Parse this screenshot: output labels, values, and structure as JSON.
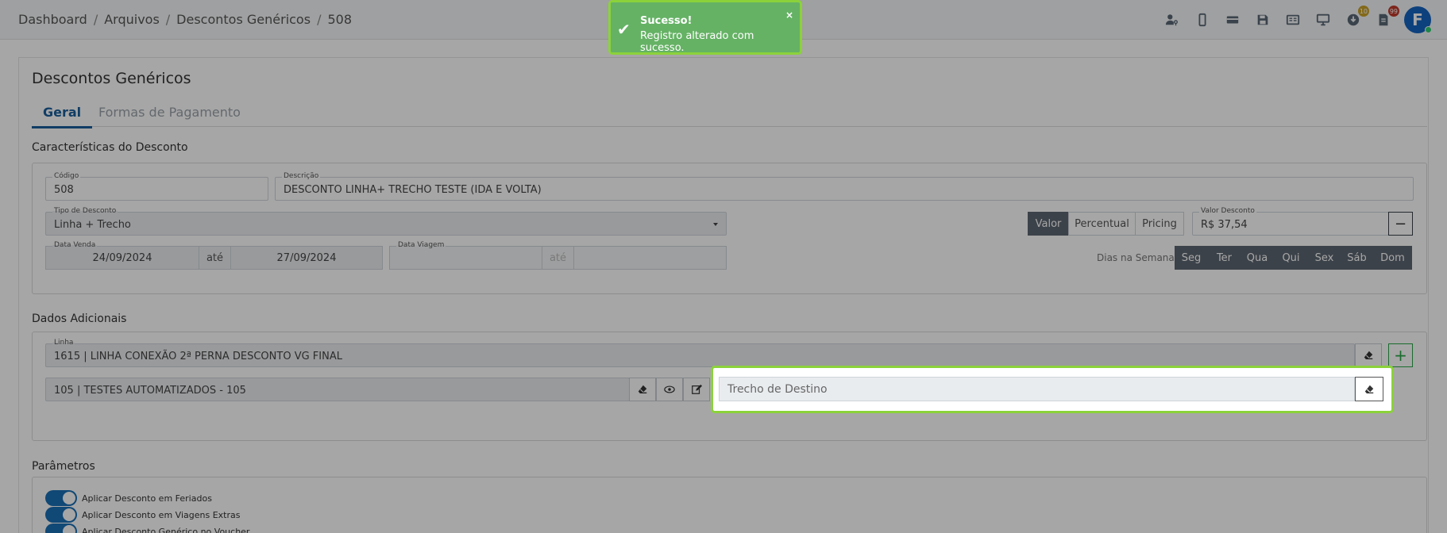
{
  "breadcrumb": [
    "Dashboard",
    "Arquivos",
    "Descontos Genéricos",
    "508"
  ],
  "header_icons": [
    {
      "name": "user-key-icon",
      "badge": ""
    },
    {
      "name": "mobile-icon",
      "badge": ""
    },
    {
      "name": "card-icon",
      "badge": ""
    },
    {
      "name": "save-icon",
      "badge": ""
    },
    {
      "name": "register-icon",
      "badge": ""
    },
    {
      "name": "monitor-icon",
      "badge": ""
    },
    {
      "name": "download-icon",
      "badge": "10"
    },
    {
      "name": "document-icon",
      "badge": "99"
    }
  ],
  "badge_colors": {
    "download": "#c9a227",
    "document": "#c0392b"
  },
  "avatar": {
    "initial": "F"
  },
  "page": {
    "title": "Descontos Genéricos"
  },
  "tabs": [
    {
      "label": "Geral",
      "active": true
    },
    {
      "label": "Formas de Pagamento",
      "active": false
    }
  ],
  "sections": {
    "caracteristicas": "Características do Desconto",
    "dados_adicionais": "Dados Adicionais",
    "parametros": "Parâmetros"
  },
  "form": {
    "codigo": {
      "label": "Código",
      "value": "508"
    },
    "descricao": {
      "label": "Descrição",
      "value": "DESCONTO LINHA+ TRECHO TESTE (IDA E VOLTA)"
    },
    "tipo_desconto": {
      "label": "Tipo de Desconto",
      "value": "Linha + Trecho"
    },
    "tipo_valor": {
      "options": [
        "Valor",
        "Percentual",
        "Pricing"
      ],
      "selected": "Valor"
    },
    "valor_desconto": {
      "label": "Valor Desconto",
      "value": "R$ 37,54",
      "minus": "−"
    },
    "data_venda": {
      "label": "Data Venda",
      "from": "24/09/2024",
      "sep": "até",
      "to": "27/09/2024"
    },
    "data_viagem": {
      "label": "Data Viagem",
      "from": "",
      "sep": "até",
      "to": ""
    },
    "dias_semana": {
      "label": "Dias na Semana",
      "days": [
        "Seg",
        "Ter",
        "Qua",
        "Qui",
        "Sex",
        "Sáb",
        "Dom"
      ]
    }
  },
  "dados_adicionais": {
    "linha": {
      "label": "Linha",
      "value": "1615 | LINHA CONEXÃO 2ª PERNA DESCONTO VG FINAL",
      "add": "+"
    },
    "trecho_origem": {
      "value": "105 | TESTES AUTOMATIZADOS - 105"
    },
    "trecho_destino": {
      "placeholder": "Trecho de Destino"
    }
  },
  "parametros": [
    "Aplicar Desconto em Feriados",
    "Aplicar Desconto em Viagens Extras",
    "Aplicar Desconto Genérico no Voucher"
  ],
  "toast": {
    "title": "Sucesso!",
    "message": "Registro alterado com sucesso.",
    "close": "×",
    "check": "✔",
    "color": "#65b265"
  }
}
